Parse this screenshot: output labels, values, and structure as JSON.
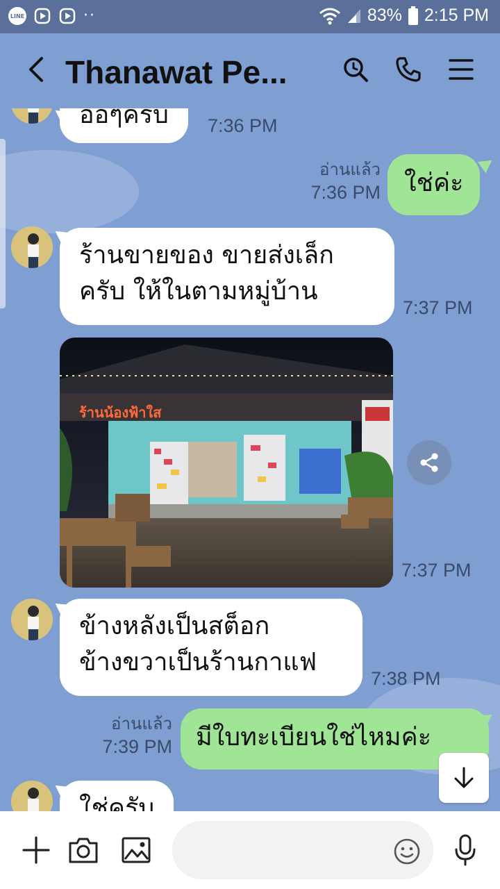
{
  "status_bar": {
    "app_icon_text": "LINE",
    "dots": "··",
    "battery": "83%",
    "time": "2:15 PM"
  },
  "header": {
    "title": "Thanawat Pe..."
  },
  "messages": [
    {
      "side": "in",
      "text": "อ่อๆครับ",
      "time": "7:36 PM"
    },
    {
      "side": "out",
      "text": "ใช่ค่ะ",
      "read": "อ่านแล้ว",
      "time": "7:36 PM"
    },
    {
      "side": "in",
      "lines": [
        "ร้านขายของ ขายส่งเล็ก",
        "ครับ ให้ในตามหมู่บ้าน"
      ],
      "time": "7:37 PM"
    },
    {
      "side": "in",
      "type": "image",
      "image_text": "ร้านน้องฟ้าใส",
      "time": "7:37 PM"
    },
    {
      "side": "in",
      "lines": [
        "ข้างหลังเป็นสต็อก",
        "ข้างขวาเป็นร้านกาแฟ"
      ],
      "time": "7:38 PM"
    },
    {
      "side": "out",
      "text": "มีใบทะเบียนใช่ไหมค่ะ",
      "read": "อ่านแล้ว",
      "time": "7:39 PM"
    },
    {
      "side": "in",
      "text": "ใช่ครับ"
    }
  ],
  "footer": {
    "input_placeholder": ""
  },
  "colors": {
    "chat_background": "#7f9fd3",
    "status_bar": "#5a6f99",
    "incoming_bubble": "#ffffff",
    "outgoing_bubble": "#a0e596"
  },
  "icons": [
    "line-icon",
    "play-icon",
    "wifi-icon",
    "signal-icon",
    "battery-icon",
    "back-icon",
    "search-icon",
    "phone-icon",
    "menu-icon",
    "share-icon",
    "arrow-down-icon",
    "plus-icon",
    "camera-icon",
    "image-icon",
    "emoji-icon",
    "mic-icon"
  ]
}
